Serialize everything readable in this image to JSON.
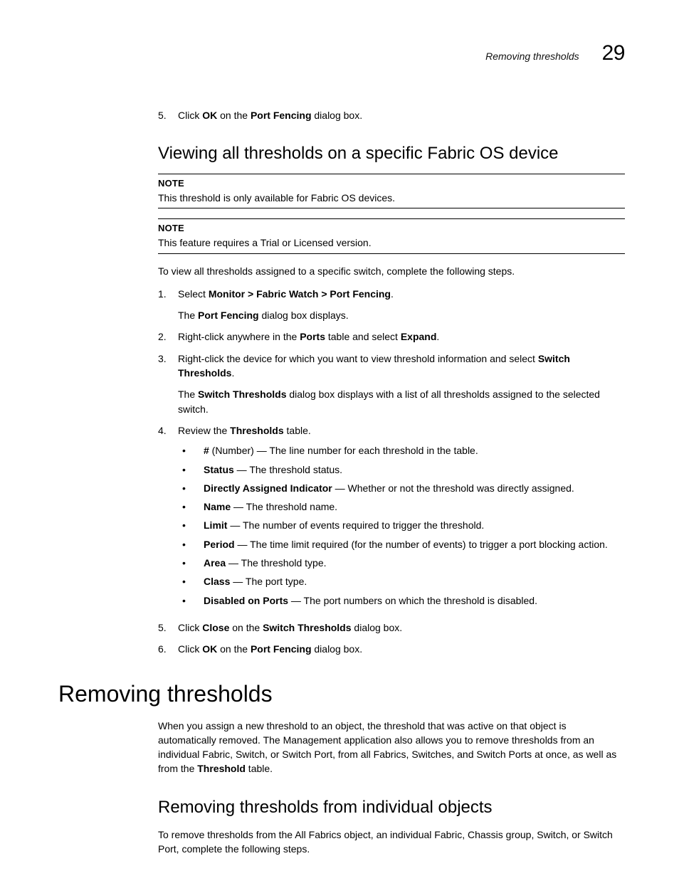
{
  "header": {
    "title": "Removing thresholds",
    "chapter": "29"
  },
  "step5_top": {
    "num": "5.",
    "pre": "Click ",
    "b1": "OK",
    "mid": " on the ",
    "b2": "Port Fencing",
    "post": " dialog box."
  },
  "sec1": {
    "heading": "Viewing all thresholds on a specific Fabric OS device",
    "note1_label": "NOTE",
    "note1_text": "This threshold is only available for Fabric OS devices.",
    "note2_label": "NOTE",
    "note2_text": "This feature requires a Trial or Licensed version.",
    "intro": "To view all thresholds assigned to a specific switch, complete the following steps.",
    "steps": {
      "s1": {
        "num": "1.",
        "pre": "Select ",
        "b1": "Monitor > Fabric Watch > Port Fencing",
        "post": ".",
        "res_pre": "The ",
        "res_b": "Port Fencing",
        "res_post": " dialog box displays."
      },
      "s2": {
        "num": "2.",
        "pre": "Right-click anywhere in the ",
        "b1": "Ports",
        "mid": " table and select ",
        "b2": "Expand",
        "post": "."
      },
      "s3": {
        "num": "3.",
        "pre": "Right-click the device for which you want to view threshold information and select ",
        "b1": "Switch Thresholds",
        "post": ".",
        "res_pre": "The ",
        "res_b": "Switch Thresholds",
        "res_post": " dialog box displays with a list of all thresholds assigned to the selected switch."
      },
      "s4": {
        "num": "4.",
        "pre": "Review the ",
        "b1": "Thresholds",
        "post": " table."
      },
      "s5": {
        "num": "5.",
        "pre": "Click ",
        "b1": "Close",
        "mid": " on the ",
        "b2": "Switch Thresholds",
        "post": " dialog box."
      },
      "s6": {
        "num": "6.",
        "pre": "Click ",
        "b1": "OK",
        "mid": " on the ",
        "b2": "Port Fencing",
        "post": " dialog box."
      }
    },
    "bullets": {
      "b0": {
        "term": "#",
        "desc": " (Number) — The line number for each threshold in the table."
      },
      "b1": {
        "term": "Status",
        "desc": " — The threshold status."
      },
      "b2": {
        "term": "Directly Assigned Indicator",
        "desc": " — Whether or not the threshold was directly assigned."
      },
      "b3": {
        "term": "Name",
        "desc": " — The threshold name."
      },
      "b4": {
        "term": "Limit",
        "desc": " — The number of events required to trigger the threshold."
      },
      "b5": {
        "term": "Period",
        "desc": " — The time limit required (for the number of events) to trigger a port blocking action."
      },
      "b6": {
        "term": "Area",
        "desc": " — The threshold type."
      },
      "b7": {
        "term": "Class",
        "desc": " — The port type."
      },
      "b8": {
        "term": "Disabled on Ports",
        "desc": " — The port numbers on which the threshold is disabled."
      }
    }
  },
  "sec2": {
    "heading": "Removing thresholds",
    "intro_pre": "When you assign a new threshold to an object, the threshold that was active on that object is automatically removed. The Management application also allows you to remove thresholds from an individual Fabric, Switch, or Switch Port, from all Fabrics, Switches, and Switch Ports at once, as well as from the ",
    "intro_b": "Threshold",
    "intro_post": " table.",
    "sub_heading": "Removing thresholds from individual objects",
    "sub_intro": "To remove thresholds from the All Fabrics object, an individual Fabric, Chassis group, Switch, or Switch Port, complete the following steps."
  }
}
